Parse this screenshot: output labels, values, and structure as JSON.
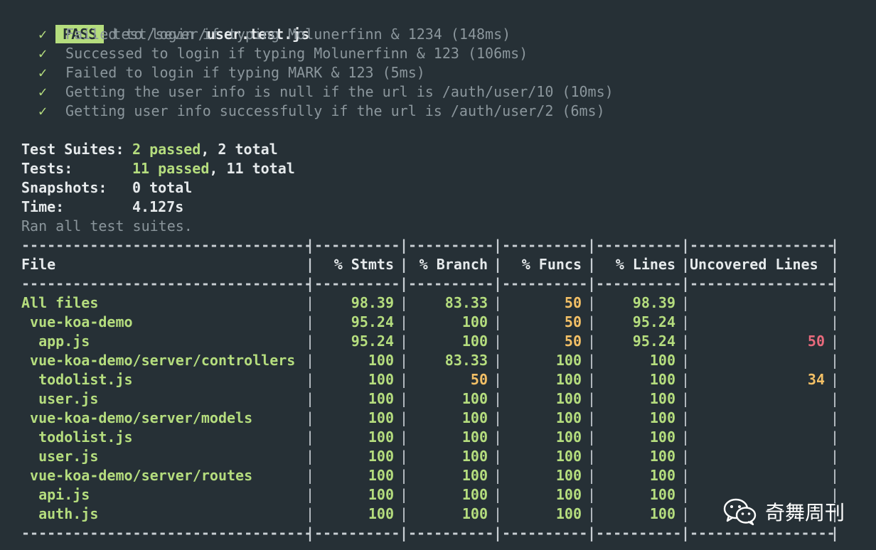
{
  "header": {
    "badge": "PASS",
    "path_prefix": "test/sever/",
    "path_file": "user.test.js"
  },
  "tests": [
    {
      "check": "✓",
      "text": "Failed to login if typing Molunerfinn & 1234 (148ms)"
    },
    {
      "check": "✓",
      "text": "Successed to login if typing Molunerfinn & 123 (106ms)"
    },
    {
      "check": "✓",
      "text": "Failed to login if typing MARK & 123 (5ms)"
    },
    {
      "check": "✓",
      "text": "Getting the user info is null if the url is /auth/user/10 (10ms)"
    },
    {
      "check": "✓",
      "text": "Getting user info successfully if the url is /auth/user/2 (6ms)"
    }
  ],
  "summary": {
    "suites_label": "Test Suites:",
    "suites_passed": "2 passed",
    "suites_total": ", 2 total",
    "tests_label": "Tests:",
    "tests_passed": "11 passed",
    "tests_total": ", 11 total",
    "snapshots_label": "Snapshots:",
    "snapshots_value": "0 total",
    "time_label": "Time:",
    "time_value": "4.127s",
    "ran_all": "Ran all test suites."
  },
  "coverage": {
    "dash_file": "----------------------------------",
    "dash_num": "----------",
    "dash_unc": "-----------------",
    "sep": "|",
    "headers": {
      "file": "File",
      "stmts": "% Stmts",
      "branch": "% Branch",
      "funcs": "% Funcs",
      "lines": "% Lines",
      "uncovered": "Uncovered Lines"
    },
    "rows": [
      {
        "file": "All files",
        "stmts": "98.39",
        "branch": "83.33",
        "funcs": "50",
        "lines": "98.39",
        "uncovered": ""
      },
      {
        "file": " vue-koa-demo",
        "stmts": "95.24",
        "branch": "100",
        "funcs": "50",
        "lines": "95.24",
        "uncovered": ""
      },
      {
        "file": "  app.js",
        "stmts": "95.24",
        "branch": "100",
        "funcs": "50",
        "lines": "95.24",
        "uncovered": "50"
      },
      {
        "file": " vue-koa-demo/server/controllers",
        "stmts": "100",
        "branch": "83.33",
        "funcs": "100",
        "lines": "100",
        "uncovered": ""
      },
      {
        "file": "  todolist.js",
        "stmts": "100",
        "branch": "50",
        "funcs": "100",
        "lines": "100",
        "uncovered": "34"
      },
      {
        "file": "  user.js",
        "stmts": "100",
        "branch": "100",
        "funcs": "100",
        "lines": "100",
        "uncovered": ""
      },
      {
        "file": " vue-koa-demo/server/models",
        "stmts": "100",
        "branch": "100",
        "funcs": "100",
        "lines": "100",
        "uncovered": ""
      },
      {
        "file": "  todolist.js",
        "stmts": "100",
        "branch": "100",
        "funcs": "100",
        "lines": "100",
        "uncovered": ""
      },
      {
        "file": "  user.js",
        "stmts": "100",
        "branch": "100",
        "funcs": "100",
        "lines": "100",
        "uncovered": ""
      },
      {
        "file": " vue-koa-demo/server/routes",
        "stmts": "100",
        "branch": "100",
        "funcs": "100",
        "lines": "100",
        "uncovered": ""
      },
      {
        "file": "  api.js",
        "stmts": "100",
        "branch": "100",
        "funcs": "100",
        "lines": "100",
        "uncovered": ""
      },
      {
        "file": "  auth.js",
        "stmts": "100",
        "branch": "100",
        "funcs": "100",
        "lines": "100",
        "uncovered": ""
      }
    ]
  },
  "colors": {
    "green": "#b5dd7e",
    "yellow": "#f3c066",
    "red": "#e86a7c"
  },
  "watermark": {
    "icon": "wechat-icon",
    "text": "奇舞周刊"
  }
}
